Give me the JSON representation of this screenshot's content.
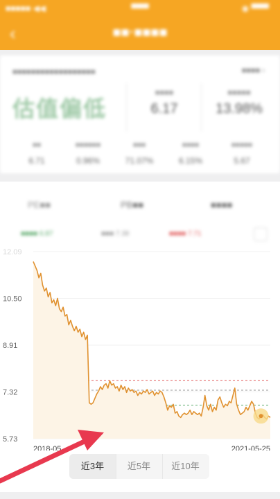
{
  "status_bar": {
    "left": "■■■■■ ◀◀",
    "center": "▀▀▀",
    "right": "◉ ▀▀▀"
  },
  "header": {
    "back_icon": "‹",
    "title": "■■·■■■■"
  },
  "summary": {
    "index_name": "■■■■■■■■■■■■■■■■■■",
    "index_link": "■■■■ ›",
    "valuation": "估值偏低",
    "metric1": {
      "label": "■■■■",
      "value": "6.17"
    },
    "metric2": {
      "label": "■■■■■",
      "value": "13.98%"
    },
    "stats": [
      {
        "label": "■■",
        "value": "6.71"
      },
      {
        "label": "■■■■■■",
        "value": "0.96%"
      },
      {
        "label": "■■■",
        "value": "71.07%"
      },
      {
        "label": "■■■■",
        "value": "6.15%"
      },
      {
        "label": "■■■■■",
        "value": "5.67"
      }
    ]
  },
  "chart_tabs": [
    "PE■■",
    "PB■■",
    "■■■■"
  ],
  "legend": [
    {
      "label": "■■■■ 6.87",
      "color": "#5aa96a"
    },
    {
      "label": "■■■ 7.38",
      "color": "#999999"
    },
    {
      "label": "■■■■ 7.71",
      "color": "#e05a5a"
    }
  ],
  "chart_data": {
    "type": "line",
    "x_start": "2018-05",
    "x_end": "2021-05-25",
    "y_ticks": [
      5.73,
      7.32,
      8.91,
      10.5,
      12.09
    ],
    "ylim": [
      5.73,
      12.09
    ],
    "reference_lines": [
      {
        "value": 7.71,
        "color": "#e05a5a"
      },
      {
        "value": 7.38,
        "color": "#999999"
      },
      {
        "value": 6.87,
        "color": "#5aa96a"
      }
    ],
    "series": [
      {
        "color": "#e0912f",
        "values": [
          11.75,
          11.6,
          11.45,
          11.2,
          11.35,
          10.95,
          10.75,
          10.85,
          10.55,
          10.7,
          10.35,
          10.45,
          10.25,
          10.5,
          10.15,
          10.05,
          10.2,
          9.9,
          9.95,
          9.6,
          9.75,
          9.55,
          9.4,
          9.55,
          9.35,
          9.45,
          9.2,
          9.35,
          9.1,
          9.25,
          6.95,
          6.9,
          6.95,
          7.1,
          7.25,
          7.35,
          7.5,
          7.4,
          7.55,
          7.6,
          7.45,
          7.7,
          7.55,
          7.6,
          7.45,
          7.5,
          7.35,
          7.55,
          7.4,
          7.5,
          7.3,
          7.45,
          7.35,
          7.4,
          7.3,
          7.35,
          7.2,
          7.3,
          7.25,
          7.35,
          7.3,
          7.4,
          7.25,
          7.3,
          7.35,
          7.2,
          7.3,
          7.25,
          7.35,
          7.3,
          7.15,
          6.95,
          6.7,
          6.85,
          6.8,
          6.9,
          6.6,
          6.65,
          6.5,
          6.45,
          6.55,
          6.6,
          6.55,
          6.6,
          6.7,
          6.55,
          6.65,
          6.6,
          6.55,
          6.6,
          6.5,
          6.8,
          7.2,
          6.85,
          6.7,
          6.9,
          6.65,
          6.8,
          6.7,
          7.05,
          7.15,
          6.95,
          6.8,
          6.9,
          6.85,
          7.0,
          6.95,
          7.2,
          7.45,
          6.9,
          6.7,
          6.55,
          6.6,
          6.65,
          6.8,
          6.7,
          6.85,
          7.0,
          6.9,
          6.6,
          6.45,
          6.4,
          6.5,
          6.55,
          6.45,
          6.4,
          6.5,
          6.45
        ]
      }
    ],
    "current_value": 6.45
  },
  "period_tabs": [
    {
      "label": "近3年",
      "active": true
    },
    {
      "label": "近5年",
      "active": false
    },
    {
      "label": "近10年",
      "active": false
    }
  ]
}
